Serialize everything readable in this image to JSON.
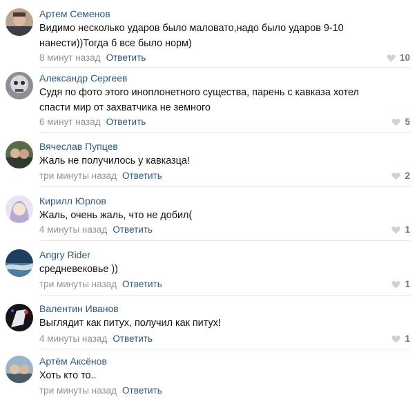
{
  "heart_color": "#c9d2dd",
  "comments": [
    {
      "author": "Артем Семенов",
      "text": "Видимо несколько ударов было маловато,надо было ударов 9-10\nнанести))Тогда б все было норм)",
      "time": "8 минут назад",
      "reply": "Ответить",
      "likes": "10",
      "avatar": "avatar-photo"
    },
    {
      "author": "Александр Сергеев",
      "text": "Судя по фото этого иноплонетного существа, парень с кавказа хотел\nспасти мир от захватчика не земного",
      "time": "6 минут назад",
      "reply": "Ответить",
      "likes": "5",
      "avatar": "avatar-photo"
    },
    {
      "author": "Вячеслав Пупцев",
      "text": "Жаль не получилось у кавказца!",
      "time": "три минуты назад",
      "reply": "Ответить",
      "likes": "2",
      "avatar": "avatar-photo"
    },
    {
      "author": "Кирилл Юрлов",
      "text": "Жаль, очень жаль, что не добил(",
      "time": "4 минуты назад",
      "reply": "Ответить",
      "likes": "1",
      "avatar": "avatar-photo"
    },
    {
      "author": "Angry Rider",
      "text": "средневековье ))",
      "time": "три минуты назад",
      "reply": "Ответить",
      "likes": "1",
      "avatar": "avatar-photo"
    },
    {
      "author": "Валентин Иванов",
      "text": "Выглядит как питух, получил как питух!",
      "time": "4 минуты назад",
      "reply": "Ответить",
      "likes": "1",
      "avatar": "avatar-photo"
    },
    {
      "author": "Артём Аксёнов",
      "text": "Хоть кто то..",
      "time": "три минуты назад",
      "reply": "Ответить",
      "likes": "",
      "avatar": "avatar-photo"
    }
  ]
}
